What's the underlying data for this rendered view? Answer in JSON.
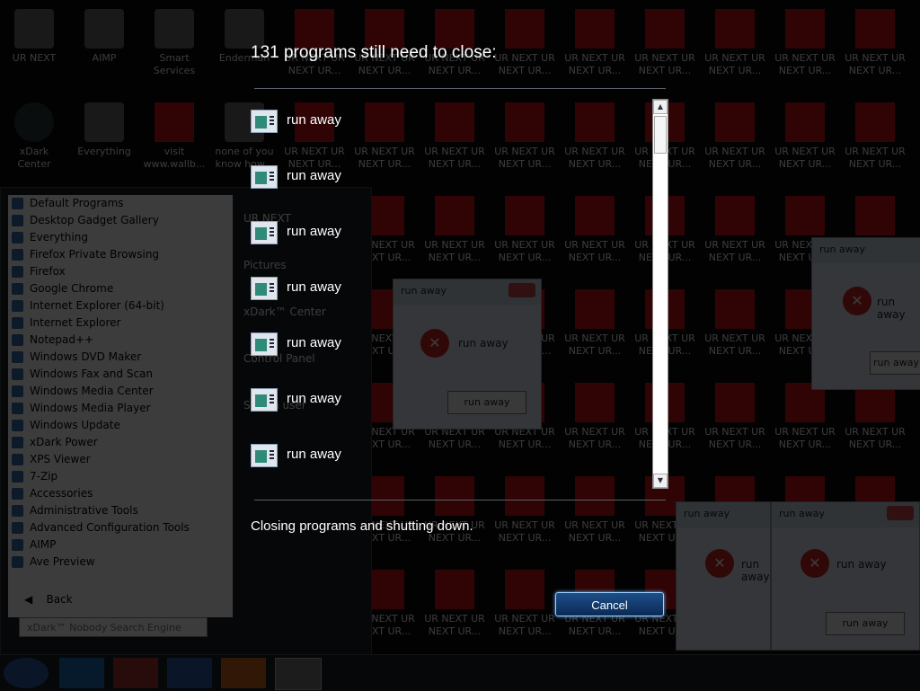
{
  "dialog": {
    "heading": "131 programs still need to close:",
    "status": "Closing programs and shutting down.",
    "cancel_label": "Cancel",
    "programs": [
      "run away",
      "run away",
      "run away",
      "run away",
      "run away",
      "run away",
      "run away"
    ]
  },
  "desktop": {
    "icons": [
      "UR NEXT",
      "AIMP",
      "Smart Services",
      "Enderman",
      "xDark Center",
      "Everything",
      "visit www.wallb...",
      "none of you know how..."
    ],
    "red_icon_label": "UR NEXT UR NEXT UR..."
  },
  "start_menu": {
    "items": [
      "Default Programs",
      "Desktop Gadget Gallery",
      "Everything",
      "Firefox Private Browsing",
      "Firefox",
      "Google Chrome",
      "Internet Explorer (64-bit)",
      "Internet Explorer",
      "Notepad++",
      "Windows DVD Maker",
      "Windows Fax and Scan",
      "Windows Media Center",
      "Windows Media Player",
      "Windows Update",
      "xDark Power",
      "XPS Viewer",
      "7-Zip",
      "Accessories",
      "Administrative Tools",
      "Advanced Configuration Tools",
      "AIMP",
      "Ave Preview"
    ],
    "back_label": "Back",
    "search_placeholder": "xDark™ Nobody Search Engine",
    "right_items": [
      "UR NEXT",
      "Pictures",
      "xDark™ Center",
      "Control Panel",
      "Switch user"
    ]
  },
  "error_windows": {
    "title": "run away",
    "message": "run away",
    "button": "run away"
  },
  "colors": {
    "accent": "#1c4f8a",
    "desktop_red": "#cc1111"
  }
}
